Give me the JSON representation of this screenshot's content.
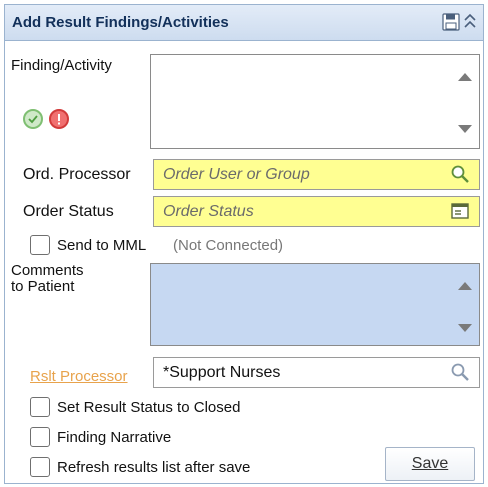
{
  "header": {
    "title": "Add Result Findings/Activities",
    "save_icon": "save-icon",
    "collapse_icon": "collapse-up-icon"
  },
  "finding": {
    "label": "Finding/Activity",
    "value": "",
    "status_icons": [
      "check-circle-icon",
      "error-circle-icon"
    ]
  },
  "ord_processor": {
    "label": "Ord. Processor",
    "placeholder": "Order User or Group",
    "icon": "search-icon"
  },
  "order_status": {
    "label": "Order Status",
    "placeholder": "Order Status",
    "icon": "list-picker-icon"
  },
  "send_mml": {
    "label": "Send to MML",
    "status": "(Not Connected)",
    "checked": false
  },
  "comments": {
    "label_line1": "Comments",
    "label_line2": "to Patient",
    "value": ""
  },
  "rslt_processor": {
    "label": "Rslt Processor",
    "value": "*Support Nurses",
    "icon": "search-icon"
  },
  "options": {
    "set_closed": "Set Result Status to Closed",
    "finding_narrative": "Finding Narrative",
    "refresh": "Refresh results list after save"
  },
  "save_button": "Save",
  "colors": {
    "header_bg": "#cddcef",
    "required_field": "#ffff92",
    "comments_bg": "#c6d8f2",
    "link": "#e8a34c"
  }
}
